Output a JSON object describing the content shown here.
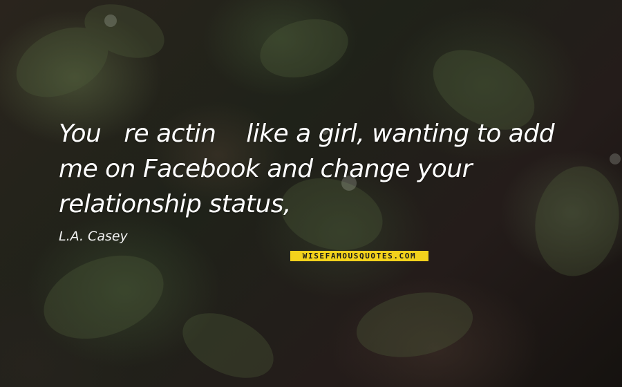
{
  "quote": {
    "text": "You   re actin    like a girl, wanting to add me on Facebook and change your relationship status,",
    "author": "L.A. Casey"
  },
  "watermark": {
    "text": "WISEFAMOUSQUOTES.COM",
    "background_color": "#f3d21c"
  },
  "background": {
    "subject": "dark green leaves with water droplets",
    "colors": [
      "#2a241d",
      "#1f2219",
      "#5f6e46"
    ]
  }
}
